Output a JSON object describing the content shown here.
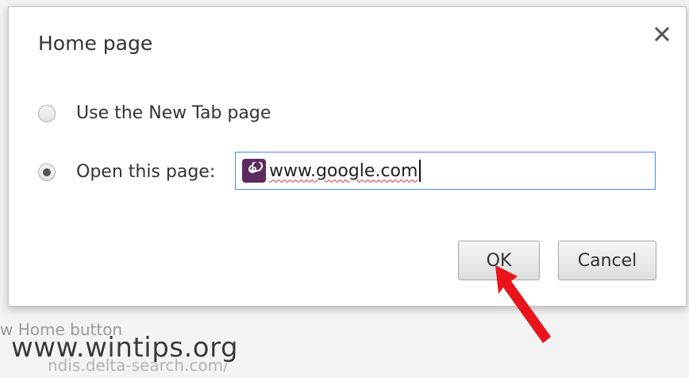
{
  "background": {
    "home_button_label": "w Home button",
    "url_fragment": "ndis.delta-search.com/",
    "watermark": "www.wintips.org"
  },
  "dialog": {
    "title": "Home page",
    "close_icon": "close-icon",
    "options": [
      {
        "label": "Use the New Tab page",
        "checked": false
      },
      {
        "label": "Open this page:",
        "checked": true
      }
    ],
    "url_input": {
      "value": "www.google.com",
      "favicon": "delta-search-swirl-icon"
    },
    "ok_label": "OK",
    "cancel_label": "Cancel"
  },
  "colors": {
    "focus_border": "#4d90fe",
    "favicon_bg": "#5b2b5e",
    "arrow": "#e8131b"
  }
}
